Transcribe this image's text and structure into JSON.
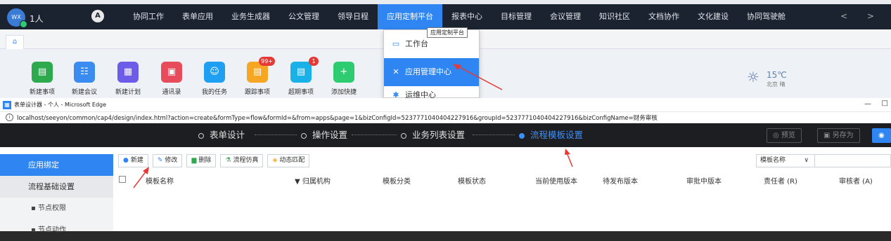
{
  "colors": {
    "nav_bg": "#1c2330",
    "accent": "#2f86f2",
    "step_active": "#3d8ef5",
    "dark_header": "#1d1e22"
  },
  "topbar": {
    "avatar_text": "WX",
    "user_name": "1人",
    "logo_icon": "A",
    "nav": [
      "协同工作",
      "表单应用",
      "业务生成器",
      "公文管理",
      "领导日程",
      "应用定制平台",
      "报表中心",
      "目标管理",
      "会议管理",
      "知识社区",
      "文档协作",
      "文化建设",
      "协同驾驶舱"
    ],
    "active_nav": "应用定制平台",
    "arrows": "< >"
  },
  "home_icon": "⌂",
  "quick_items": [
    {
      "label": "新建事项",
      "color": "#2eaa4e",
      "icon": "▤",
      "badge": ""
    },
    {
      "label": "新建会议",
      "color": "#3a8cf0",
      "icon": "☷",
      "badge": ""
    },
    {
      "label": "新建计划",
      "color": "#6c5ce7",
      "icon": "▦",
      "badge": ""
    },
    {
      "label": "通讯录",
      "color": "#e74c5b",
      "icon": "▣",
      "badge": ""
    },
    {
      "label": "我的任务",
      "color": "#1e9ff2",
      "icon": "☺",
      "badge": ""
    },
    {
      "label": "跟踪事项",
      "color": "#f5a623",
      "icon": "▤",
      "badge": "99+"
    },
    {
      "label": "超期事项",
      "color": "#1ab0e8",
      "icon": "▤",
      "badge": "1"
    },
    {
      "label": "添加快捷",
      "color": "#2ecc71",
      "icon": "+",
      "badge": ""
    }
  ],
  "weather": {
    "icon": "☼",
    "temp": "15℃",
    "city": "北京 晴"
  },
  "dropdown": {
    "tooltip": "应用定制平台",
    "items": [
      {
        "label": "工作台",
        "icon": "▭"
      },
      {
        "label": "应用管理中心",
        "icon": "✕"
      },
      {
        "label": "运维中心",
        "icon": "✱"
      }
    ]
  },
  "edge": {
    "window_title": "表单设计器 - 个人 - Microsoft Edge",
    "min": "—",
    "max": "□",
    "url": "localhost/seeyon/common/cap4/design/index.html?action=create&formType=flow&formId=&from=apps&page=1&bizConfigId=5237771040404227916&groupId=5237771040404227916&bizConfigName=财务审核"
  },
  "steps": [
    {
      "label": "表单设计",
      "active": false
    },
    {
      "label": "操作设置",
      "active": false
    },
    {
      "label": "业务列表设置",
      "active": false
    },
    {
      "label": "流程模板设置",
      "active": true
    }
  ],
  "header_buttons": {
    "preview": "预览",
    "save_as": "另存为"
  },
  "sidebar": {
    "items": [
      "应用绑定",
      "流程基础设置",
      "节点权限",
      "节点动作"
    ]
  },
  "toolbar": [
    {
      "label": "新建",
      "icon": "●",
      "icon_color": "#2f86f2"
    },
    {
      "label": "修改",
      "icon": "✎",
      "icon_color": "#2f86f2"
    },
    {
      "label": "删除",
      "icon": "▆",
      "icon_color": "#2eaa4e"
    },
    {
      "label": "流程仿真",
      "icon": "⚗",
      "icon_color": "#2eaa4e"
    },
    {
      "label": "动态匹配",
      "icon": "◈",
      "icon_color": "#f5a623"
    }
  ],
  "filter": {
    "label": "模板名称",
    "caret": "∨"
  },
  "table": {
    "headers": [
      "模板名称",
      "▼ 归属机构",
      "模板分类",
      "模板状态",
      "当前使用版本",
      "待发布版本",
      "审批中版本",
      "责任者 (R)",
      "审核者 (A)"
    ]
  }
}
